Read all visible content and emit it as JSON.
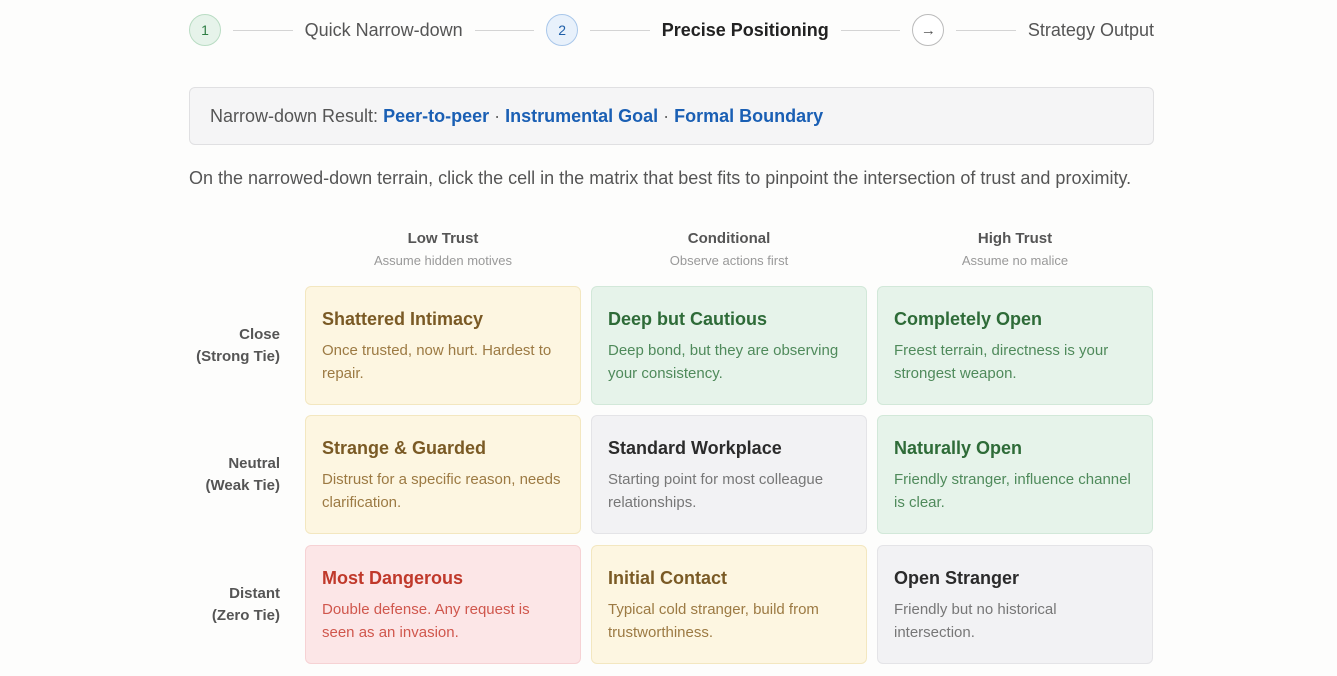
{
  "stepper": {
    "steps": [
      {
        "marker": "1",
        "label": "Quick Narrow-down",
        "state": "done"
      },
      {
        "marker": "2",
        "label": "Precise Positioning",
        "state": "active"
      },
      {
        "marker": "→",
        "label": "Strategy Output",
        "state": "next"
      }
    ]
  },
  "result": {
    "prefix": "Narrow-down Result:",
    "tags": [
      "Peer-to-peer",
      "Instrumental Goal",
      "Formal Boundary"
    ],
    "separator": "·"
  },
  "instructions": "On the narrowed-down terrain, click the cell in the matrix that best fits to pinpoint the intersection of trust and proximity.",
  "matrix": {
    "columns": [
      {
        "title": "Low Trust",
        "subtitle": "Assume hidden motives"
      },
      {
        "title": "Conditional",
        "subtitle": "Observe actions first"
      },
      {
        "title": "High Trust",
        "subtitle": "Assume no malice"
      }
    ],
    "rows": [
      {
        "line1": "Close",
        "line2": "(Strong Tie)"
      },
      {
        "line1": "Neutral",
        "line2": "(Weak Tie)"
      },
      {
        "line1": "Distant",
        "line2": "(Zero Tie)"
      }
    ],
    "cells": [
      [
        {
          "title": "Shattered Intimacy",
          "desc": "Once trusted, now hurt. Hardest to repair.",
          "tone": "yellow"
        },
        {
          "title": "Deep but Cautious",
          "desc": "Deep bond, but they are observing your consistency.",
          "tone": "green"
        },
        {
          "title": "Completely Open",
          "desc": "Freest terrain, directness is your strongest weapon.",
          "tone": "green"
        }
      ],
      [
        {
          "title": "Strange & Guarded",
          "desc": "Distrust for a specific reason, needs clarification.",
          "tone": "yellow"
        },
        {
          "title": "Standard Workplace",
          "desc": "Starting point for most colleague relationships.",
          "tone": "gray"
        },
        {
          "title": "Naturally Open",
          "desc": "Friendly stranger, influence channel is clear.",
          "tone": "green"
        }
      ],
      [
        {
          "title": "Most Dangerous",
          "desc": "Double defense. Any request is seen as an invasion.",
          "tone": "red"
        },
        {
          "title": "Initial Contact",
          "desc": "Typical cold stranger, build from trustworthiness.",
          "tone": "yellow"
        },
        {
          "title": "Open Stranger",
          "desc": "Friendly but no historical intersection.",
          "tone": "gray"
        }
      ]
    ],
    "tone_colors": {
      "yellow": "#fdf6e1",
      "green": "#e6f3ea",
      "gray": "#f2f2f4",
      "red": "#fce6e7"
    }
  }
}
